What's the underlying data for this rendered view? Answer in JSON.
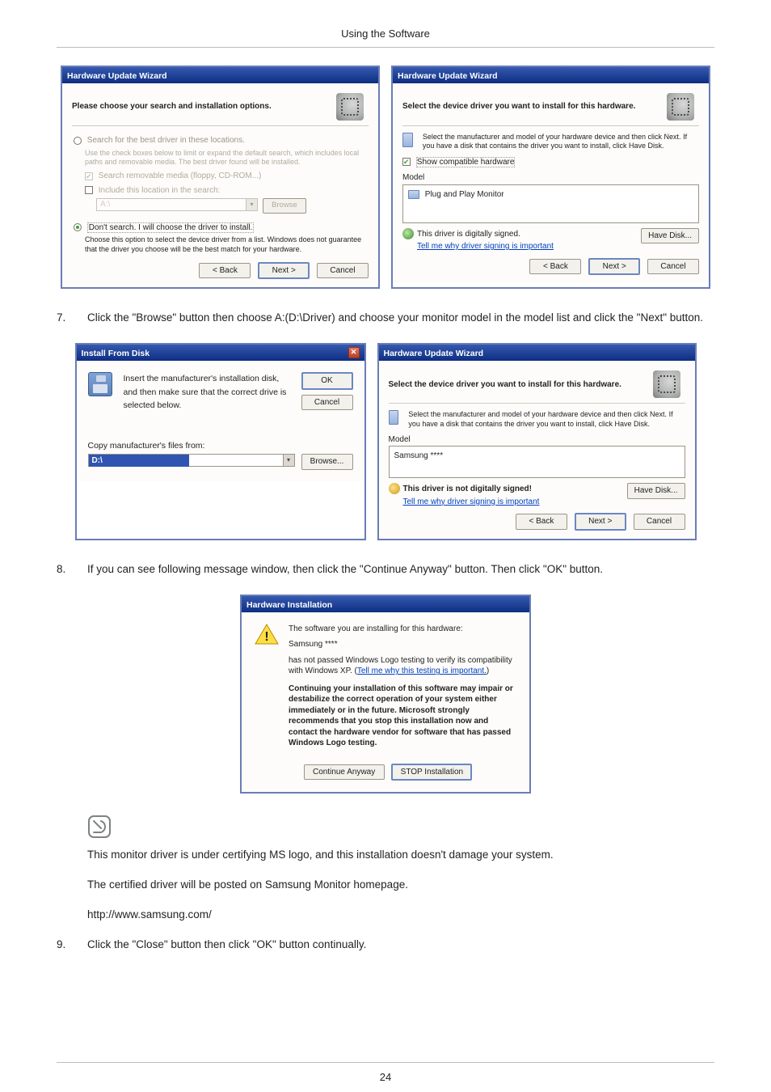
{
  "page": {
    "header": "Using the Software",
    "footer_page": "24"
  },
  "steps": {
    "s7_num": "7.",
    "s7_text": "Click the \"Browse\" button then choose A:(D:\\Driver) and choose your monitor model in the model list and click the \"Next\" button.",
    "s8_num": "8.",
    "s8_text": "If you can see following message window, then click the \"Continue Anyway\" button. Then click \"OK\" button.",
    "s9_num": "9.",
    "s9_text": "Click the \"Close\" button then click \"OK\" button continually."
  },
  "note": {
    "p1": "This monitor driver is under certifying MS logo, and this installation doesn't damage your system.",
    "p2": "The certified driver will be posted on Samsung Monitor homepage.",
    "p3": "http://www.samsung.com/"
  },
  "dlg_opts": {
    "title": "Hardware Update Wizard",
    "banner": "Please choose your search and installation options.",
    "radio1": "Search for the best driver in these locations.",
    "radio1_sub": "Use the check boxes below to limit or expand the default search, which includes local paths and removable media. The best driver found will be installed.",
    "chk1": "Search removable media (floppy, CD-ROM...)",
    "chk2": "Include this location in the search:",
    "loc_value": "A:\\",
    "browse": "Browse",
    "radio2": "Don't search. I will choose the driver to install.",
    "radio2_sub": "Choose this option to select the device driver from a list. Windows does not guarantee that the driver you choose will be the best match for your hardware.",
    "back": "< Back",
    "next": "Next >",
    "cancel": "Cancel"
  },
  "dlg_sel1": {
    "title": "Hardware Update Wizard",
    "banner": "Select the device driver you want to install for this hardware.",
    "instr": "Select the manufacturer and model of your hardware device and then click Next. If you have a disk that contains the driver you want to install, click Have Disk.",
    "chk": "Show compatible hardware",
    "model_lbl": "Model",
    "model_val": "Plug and Play Monitor",
    "cert": "This driver is digitally signed.",
    "cert_link": "Tell me why driver signing is important",
    "have": "Have Disk...",
    "back": "< Back",
    "next": "Next >",
    "cancel": "Cancel"
  },
  "dlg_ifd": {
    "title": "Install From Disk",
    "instr": "Insert the manufacturer's installation disk, and then make sure that the correct drive is selected below.",
    "ok": "OK",
    "cancel": "Cancel",
    "copy": "Copy manufacturer's files from:",
    "loc": "D:\\",
    "browse": "Browse..."
  },
  "dlg_sel2": {
    "title": "Hardware Update Wizard",
    "banner": "Select the device driver you want to install for this hardware.",
    "instr": "Select the manufacturer and model of your hardware device and then click Next. If you have a disk that contains the driver you want to install, click Have Disk.",
    "model_lbl": "Model",
    "model_val": "Samsung ****",
    "cert": "This driver is not digitally signed!",
    "cert_link": "Tell me why driver signing is important",
    "have": "Have Disk...",
    "back": "< Back",
    "next": "Next >",
    "cancel": "Cancel"
  },
  "dlg_hw": {
    "title": "Hardware Installation",
    "intro": "The software you are installing for this hardware:",
    "device": "Samsung ****",
    "logo1": "has not passed Windows Logo testing to verify its compatibility with Windows XP. (",
    "logo_link": "Tell me why this testing is important.",
    "logo2": ")",
    "warn": "Continuing your installation of this software may impair or destabilize the correct operation of your system either immediately or in the future. Microsoft strongly recommends that you stop this installation now and contact the hardware vendor for software that has passed Windows Logo testing.",
    "continue": "Continue Anyway",
    "stop": "STOP Installation"
  }
}
